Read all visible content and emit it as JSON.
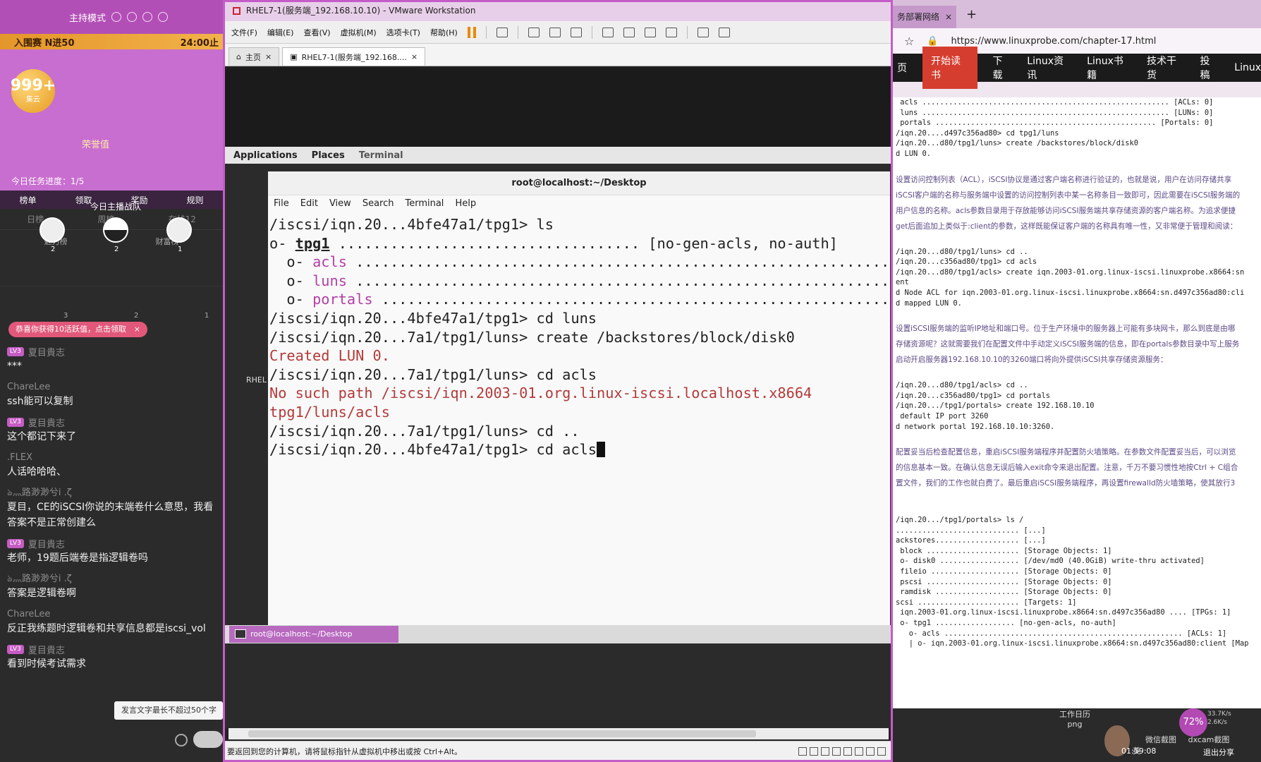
{
  "left_panel": {
    "mode_label": "主持模式",
    "rank_text": "入围赛 N进50",
    "rank_time": "24:00",
    "rank_time_suffix": "止",
    "bubble_value": "999+",
    "bubble_sub": "集云",
    "honor_label": "荣誉值",
    "task_progress": "今日任务进度：1/5",
    "anchor_war_label": "今日主播战队",
    "fan_ranks": [
      "2",
      "2",
      "1"
    ],
    "actions": [
      "榜单",
      "领取",
      "奖励",
      "规则"
    ],
    "tabs": [
      "日榜",
      "周榜",
      "在线12"
    ],
    "lb_left_title": "魅力榜",
    "lb_right_title": "财富榜",
    "lb_ranks": [
      "3",
      "2",
      "1"
    ],
    "promo_text": "恭喜你获得10活跃值，点击领取",
    "promo_close": "×",
    "messages": [
      {
        "level": "LV3",
        "name": "夏目貴志",
        "text": "***"
      },
      {
        "level": "",
        "name": "ChareLee",
        "text": "ssh能可以复制"
      },
      {
        "level": "LV3",
        "name": "夏目貴志",
        "text": "这个都记下来了"
      },
      {
        "level": "",
        "name": ".FLEX",
        "text": "人话哈哈哈、"
      },
      {
        "level": "",
        "name": "ঌ灬路渺渺兮i .ζ",
        "text": "夏目，CE的iSCSI你说的末端卷什么意思，我看答案不是正常创建么"
      },
      {
        "level": "LV3",
        "name": "夏目貴志",
        "text": "老师，19题后端卷是指逻辑卷吗"
      },
      {
        "level": "",
        "name": "ঌ灬路渺渺兮i .ζ",
        "text": "答案是逻辑卷啊"
      },
      {
        "level": "",
        "name": "ChareLee",
        "text": "反正我练题时逻辑卷和共享信息都是iscsi_vol"
      },
      {
        "level": "LV3",
        "name": "夏目貴志",
        "text": "看到时候考试需求"
      }
    ],
    "input_hint": "发言文字最长不超过50个字"
  },
  "vmware": {
    "title": "RHEL7-1(服务端_192.168.10.10) - VMware Workstation",
    "menu": [
      "文件(F)",
      "编辑(E)",
      "查看(V)",
      "虚拟机(M)",
      "选项卡(T)",
      "帮助(H)"
    ],
    "tabs": [
      "主页",
      "RHEL7-1(服务端_192.168...."
    ],
    "gnome_bar": [
      "Applications",
      "Places",
      "Terminal"
    ],
    "desktop_label": "RHEL",
    "terminal": {
      "title": "root@localhost:~/Desktop",
      "menu": [
        "File",
        "Edit",
        "View",
        "Search",
        "Terminal",
        "Help"
      ]
    },
    "taskbar_item": "root@localhost:~/Desktop",
    "status_text": "要返回到您的计算机，请将鼠标指针从虚拟机中移出或按 Ctrl+Alt。"
  },
  "browser": {
    "tab_label": "务部署网络",
    "tab_close": "×",
    "new_tab": "+",
    "url": "https://www.linuxprobe.com/chapter-17.html",
    "nav": [
      "页",
      "开始读书",
      "下载",
      "Linux资讯",
      "Linux书籍",
      "技术干货",
      "投稿",
      "Linux"
    ],
    "tray": {
      "badge": "72%",
      "speed_up": "33.7K/s",
      "speed_down": "2.6K/s",
      "time": "01:59:08",
      "share": "退出分享",
      "icon1": "工作日历",
      "icon2": "png",
      "icon3": "微信截图",
      "icon4": "dxcam截图",
      "ime": "英"
    }
  }
}
